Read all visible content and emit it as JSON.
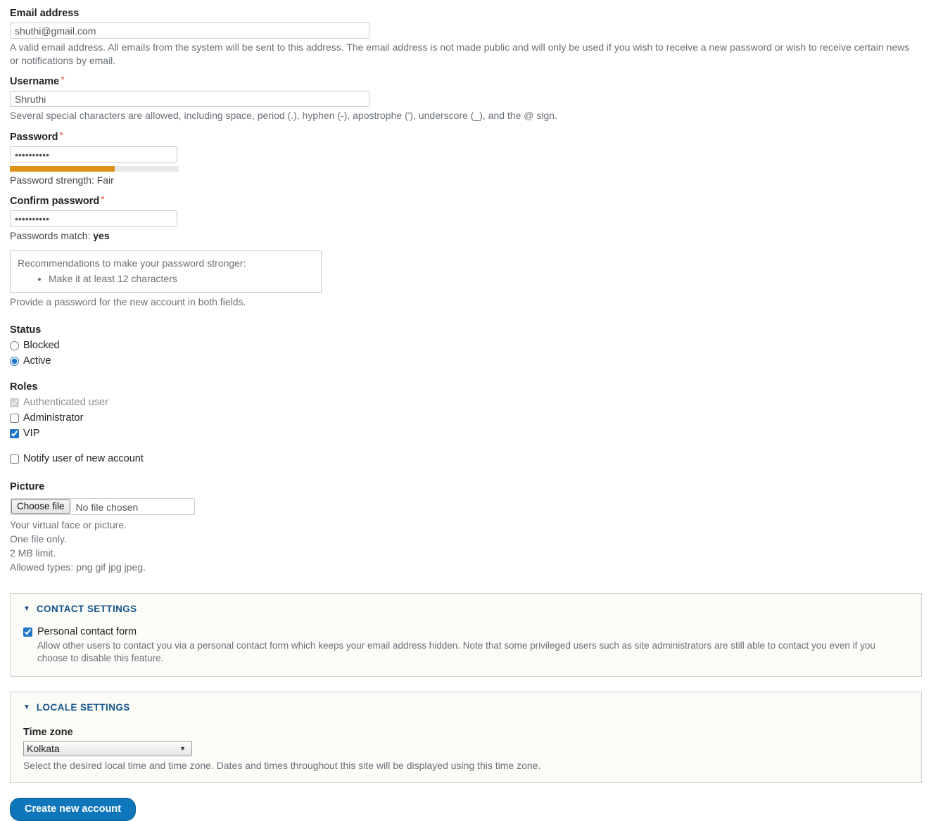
{
  "form": {
    "email": {
      "label": "Email address",
      "value": "shuthi@gmail.com",
      "description": "A valid email address. All emails from the system will be sent to this address. The email address is not made public and will only be used if you wish to receive a new password or wish to receive certain news or notifications by email."
    },
    "username": {
      "label": "Username",
      "required_marker": "*",
      "value": "Shruthi",
      "description": "Several special characters are allowed, including space, period (.), hyphen (-), apostrophe ('), underscore (_), and the @ sign."
    },
    "password": {
      "label": "Password",
      "required_marker": "*",
      "value": "••••••••••",
      "strength_label": "Password strength: Fair",
      "strength_percent": 62,
      "strength_color": "#de9117"
    },
    "confirm_password": {
      "label": "Confirm password",
      "required_marker": "*",
      "value": "••••••••••",
      "match_prefix": "Passwords match: ",
      "match_value": "yes"
    },
    "recommendations": {
      "title": "Recommendations to make your password stronger:",
      "items": [
        "Make it at least 12 characters"
      ]
    },
    "password_help": "Provide a password for the new account in both fields.",
    "status": {
      "label": "Status",
      "options": [
        {
          "label": "Blocked",
          "checked": false
        },
        {
          "label": "Active",
          "checked": true
        }
      ]
    },
    "roles": {
      "label": "Roles",
      "options": [
        {
          "label": "Authenticated user",
          "checked": true,
          "disabled": true
        },
        {
          "label": "Administrator",
          "checked": false,
          "disabled": false
        },
        {
          "label": "VIP",
          "checked": true,
          "disabled": false
        }
      ]
    },
    "notify": {
      "label": "Notify user of new account",
      "checked": false
    },
    "picture": {
      "label": "Picture",
      "choose_file_label": "Choose file",
      "file_status": "No file chosen",
      "descriptions": [
        "Your virtual face or picture.",
        "One file only.",
        "2 MB limit.",
        "Allowed types: png gif jpg jpeg."
      ]
    },
    "contact_settings": {
      "title": "Contact settings",
      "toggle_icon": "triangle-down-icon",
      "checkbox_label": "Personal contact form",
      "checked": true,
      "description": "Allow other users to contact you via a personal contact form which keeps your email address hidden. Note that some privileged users such as site administrators are still able to contact you even if you choose to disable this feature."
    },
    "locale_settings": {
      "title": "Locale settings",
      "toggle_icon": "triangle-down-icon",
      "timezone_label": "Time zone",
      "timezone_value": "Kolkata",
      "timezone_options": [
        "Kolkata"
      ],
      "description": "Select the desired local time and time zone. Dates and times throughout this site will be displayed using this time zone."
    },
    "submit": {
      "label": "Create new account",
      "color": "#1076bc"
    }
  }
}
